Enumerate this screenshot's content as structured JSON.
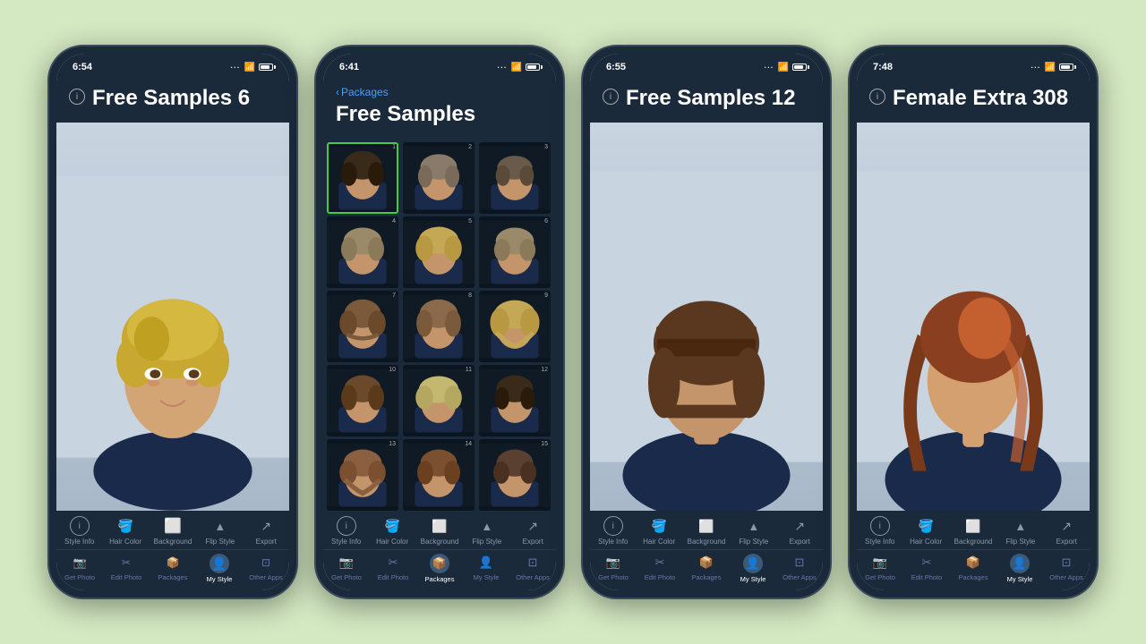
{
  "background_color": "#d4e8c2",
  "phones": [
    {
      "id": "phone1",
      "status_time": "6:54",
      "title": "Free Samples 6",
      "has_back": false,
      "view": "portrait",
      "portrait_description": "Woman with short blonde pixie cut, dark top",
      "toolbar": {
        "items": [
          {
            "id": "style-info",
            "label": "Style Info",
            "icon": "ℹ",
            "active": false
          },
          {
            "id": "hair-color",
            "label": "Hair Color",
            "icon": "🪣",
            "active": false
          },
          {
            "id": "background",
            "label": "Background",
            "icon": "🖼",
            "active": false
          },
          {
            "id": "flip-style",
            "label": "Flip Style",
            "icon": "△",
            "active": false
          },
          {
            "id": "export",
            "label": "Export",
            "icon": "↗",
            "active": false
          }
        ]
      },
      "bottom_nav": {
        "items": [
          {
            "id": "get-photo",
            "label": "Get Photo",
            "icon": "📷",
            "active": false
          },
          {
            "id": "edit-photo",
            "label": "Edit Photo",
            "icon": "⊞",
            "active": false
          },
          {
            "id": "packages",
            "label": "Packages",
            "icon": "📦",
            "active": false
          },
          {
            "id": "my-style",
            "label": "My Style",
            "icon": "👤",
            "active": true
          },
          {
            "id": "other-apps",
            "label": "Other Apps",
            "icon": "⊡",
            "active": false
          }
        ]
      }
    },
    {
      "id": "phone2",
      "status_time": "6:41",
      "title": "Free Samples",
      "has_back": true,
      "back_label": "Packages",
      "view": "grid",
      "grid_items": [
        {
          "num": 1,
          "selected": true,
          "hair_color": "#3a2a1a"
        },
        {
          "num": 2,
          "selected": false,
          "hair_color": "#5a4a3a"
        },
        {
          "num": 3,
          "selected": false,
          "hair_color": "#6a5a4a"
        },
        {
          "num": 4,
          "selected": false,
          "hair_color": "#8a7a5a"
        },
        {
          "num": 5,
          "selected": false,
          "hair_color": "#c4a855"
        },
        {
          "num": 6,
          "selected": false,
          "hair_color": "#9a8a6a"
        },
        {
          "num": 7,
          "selected": false,
          "hair_color": "#7a5a3a"
        },
        {
          "num": 8,
          "selected": false,
          "hair_color": "#8a6a4a"
        },
        {
          "num": 9,
          "selected": false,
          "hair_color": "#c4a855"
        },
        {
          "num": 10,
          "selected": false,
          "hair_color": "#6a4a2a"
        },
        {
          "num": 11,
          "selected": false,
          "hair_color": "#c4b870"
        },
        {
          "num": 12,
          "selected": false,
          "hair_color": "#3a2a1a"
        },
        {
          "num": 13,
          "selected": false,
          "hair_color": "#8a6040"
        },
        {
          "num": 14,
          "selected": false,
          "hair_color": "#7a5030"
        },
        {
          "num": 15,
          "selected": false,
          "hair_color": "#5a4030"
        }
      ],
      "toolbar": {
        "items": [
          {
            "id": "style-info",
            "label": "Style Info",
            "icon": "ℹ",
            "active": false
          },
          {
            "id": "hair-color",
            "label": "Hair Color",
            "icon": "🪣",
            "active": false
          },
          {
            "id": "background",
            "label": "Background",
            "icon": "🖼",
            "active": false
          },
          {
            "id": "flip-style",
            "label": "Flip Style",
            "icon": "△",
            "active": false
          },
          {
            "id": "export",
            "label": "Export",
            "icon": "↗",
            "active": false
          }
        ]
      },
      "bottom_nav": {
        "items": [
          {
            "id": "get-photo",
            "label": "Get Photo",
            "icon": "📷",
            "active": false
          },
          {
            "id": "edit-photo",
            "label": "Edit Photo",
            "icon": "⊞",
            "active": false
          },
          {
            "id": "packages",
            "label": "Packages",
            "icon": "📦",
            "active": true
          },
          {
            "id": "my-style",
            "label": "My Style",
            "icon": "👤",
            "active": false
          },
          {
            "id": "other-apps",
            "label": "Other Apps",
            "icon": "⊡",
            "active": false
          }
        ]
      }
    },
    {
      "id": "phone3",
      "status_time": "6:55",
      "title": "Free Samples 12",
      "has_back": false,
      "view": "portrait",
      "portrait_description": "Woman with short brown bob with bangs",
      "toolbar": {
        "items": [
          {
            "id": "style-info",
            "label": "Style Info",
            "icon": "ℹ",
            "active": false
          },
          {
            "id": "hair-color",
            "label": "Hair Color",
            "icon": "🪣",
            "active": false
          },
          {
            "id": "background",
            "label": "Background",
            "icon": "🖼",
            "active": false
          },
          {
            "id": "flip-style",
            "label": "Flip Style",
            "icon": "△",
            "active": false
          },
          {
            "id": "export",
            "label": "Export",
            "icon": "↗",
            "active": false
          }
        ]
      },
      "bottom_nav": {
        "items": [
          {
            "id": "get-photo",
            "label": "Get Photo",
            "icon": "📷",
            "active": false
          },
          {
            "id": "edit-photo",
            "label": "Edit Photo",
            "icon": "⊞",
            "active": false
          },
          {
            "id": "packages",
            "label": "Packages",
            "icon": "📦",
            "active": false
          },
          {
            "id": "my-style",
            "label": "My Style",
            "icon": "👤",
            "active": true
          },
          {
            "id": "other-apps",
            "label": "Other Apps",
            "icon": "⊡",
            "active": false
          }
        ]
      }
    },
    {
      "id": "phone4",
      "status_time": "7:48",
      "title": "Female Extra 308",
      "has_back": false,
      "view": "portrait",
      "portrait_description": "Woman with long auburn/brown layered hair",
      "toolbar": {
        "items": [
          {
            "id": "style-info",
            "label": "Style Info",
            "icon": "ℹ",
            "active": false
          },
          {
            "id": "hair-color",
            "label": "Hair Color",
            "icon": "🪣",
            "active": false
          },
          {
            "id": "background",
            "label": "Background",
            "icon": "🖼",
            "active": false
          },
          {
            "id": "flip-style",
            "label": "Flip Style",
            "icon": "△",
            "active": false
          },
          {
            "id": "export",
            "label": "Export",
            "icon": "↗",
            "active": false
          }
        ]
      },
      "bottom_nav": {
        "items": [
          {
            "id": "get-photo",
            "label": "Get Photo",
            "icon": "📷",
            "active": false
          },
          {
            "id": "edit-photo",
            "label": "Edit Photo",
            "icon": "⊞",
            "active": false
          },
          {
            "id": "packages",
            "label": "Packages",
            "icon": "📦",
            "active": false
          },
          {
            "id": "my-style",
            "label": "My Style",
            "icon": "👤",
            "active": true
          },
          {
            "id": "other-apps",
            "label": "Other Apps",
            "icon": "⊡",
            "active": false
          }
        ]
      }
    }
  ]
}
